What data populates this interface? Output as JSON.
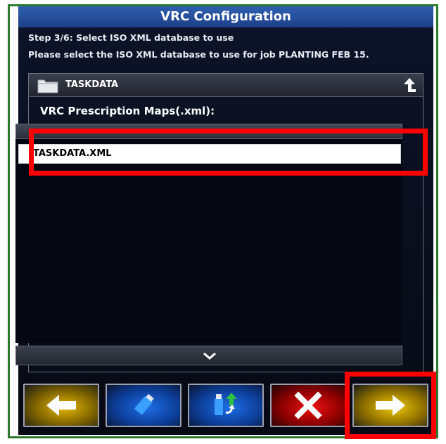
{
  "dialog": {
    "title": "VRC Configuration",
    "step": "Step 3/6: Select ISO XML database to use",
    "instruction": "Please select the ISO XML database to use for job PLANTING FEB 15."
  },
  "folder": {
    "name": "TASKDATA",
    "icon": "folder-icon",
    "up_icon": "folder-up-arrow-icon"
  },
  "list": {
    "label": "VRC Prescription Maps(.xml):",
    "items": [
      {
        "name": "TASKDATA.XML",
        "selected": true
      }
    ]
  },
  "toolbar": {
    "buttons": [
      {
        "name": "back",
        "icon": "arrow-left-icon",
        "color": "#e6b800"
      },
      {
        "name": "usb",
        "icon": "usb-drive-icon",
        "color": "#1e6ee6"
      },
      {
        "name": "import-from-usb",
        "icon": "usb-import-icon",
        "color": "#1e6ee6"
      },
      {
        "name": "cancel",
        "icon": "close-x-icon",
        "color": "#ee1010"
      },
      {
        "name": "next",
        "icon": "arrow-right-icon",
        "color": "#f0c800"
      }
    ]
  },
  "colors": {
    "title_bar": "#1c3f88",
    "highlight": "#ff0000",
    "frame": "#2d7a2d"
  }
}
